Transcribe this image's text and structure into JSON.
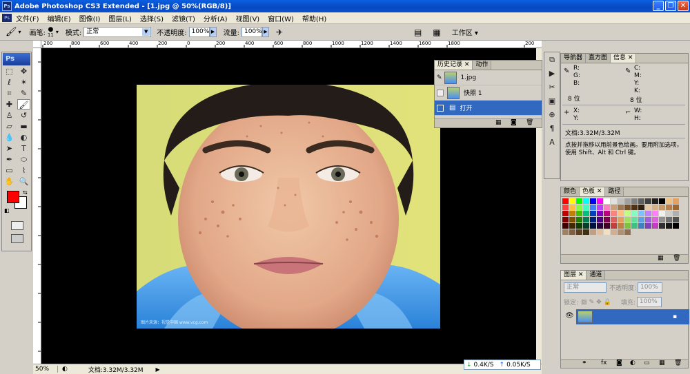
{
  "window": {
    "title": "Adobe Photoshop CS3 Extended - [1.jpg @ 50%(RGB/8)]",
    "ps_logo": "Ps"
  },
  "menu": [
    "文件(F)",
    "编辑(E)",
    "图像(I)",
    "图层(L)",
    "选择(S)",
    "滤镜(T)",
    "分析(A)",
    "视图(V)",
    "窗口(W)",
    "帮助(H)"
  ],
  "options": {
    "brush_label": "画笔:",
    "brush_size": "11",
    "mode_label": "模式:",
    "mode_value": "正常",
    "opacity_label": "不透明度:",
    "opacity_value": "100%",
    "flow_label": "流量:",
    "flow_value": "100%",
    "workspace_label": "工作区"
  },
  "ruler_ticks": [
    "200",
    "800",
    "600",
    "400",
    "200",
    "0",
    "200",
    "400",
    "600",
    "800",
    "1000",
    "1200",
    "1400",
    "1600",
    "1800",
    "200"
  ],
  "photo": {
    "watermark": "图片来源：视觉中国 www.vcg.com"
  },
  "status": {
    "zoom": "50%",
    "doc": "文档:3.32M/3.32M",
    "upload": "0.4K/S",
    "download": "0.05K/S"
  },
  "history_panel": {
    "tabs": [
      "历史记录",
      "动作"
    ],
    "items": [
      "1.jpg",
      "快照 1",
      "打开"
    ]
  },
  "info_panel": {
    "tabs": [
      "导航器",
      "直方图",
      "信息"
    ],
    "r": "R:",
    "g": "G:",
    "b": "B:",
    "c": "C:",
    "m": "M:",
    "y": "Y:",
    "k": "K:",
    "bits_left": "8 位",
    "bits_right": "8 位",
    "x": "X:",
    "yy": "Y:",
    "w": "W:",
    "h": "H:",
    "doc": "文档:3.32M/3.32M",
    "hint": "点按并拖移以用前景色绘画。要用附加选项，使用 Shift、Alt 和 Ctrl 键。"
  },
  "color_panel": {
    "tabs": [
      "颜色",
      "色板",
      "路径"
    ]
  },
  "layers_panel": {
    "tabs": [
      "图层",
      "通道"
    ],
    "blend": "正常",
    "opacity_label": "不透明度:",
    "opacity_value": "100%",
    "lock_label": "锁定:",
    "fill_label": "填充:",
    "fill_value": "100%"
  },
  "colors": {
    "foreground": "#ff0000",
    "background": "#ffffff",
    "selection": "#3168c0"
  }
}
